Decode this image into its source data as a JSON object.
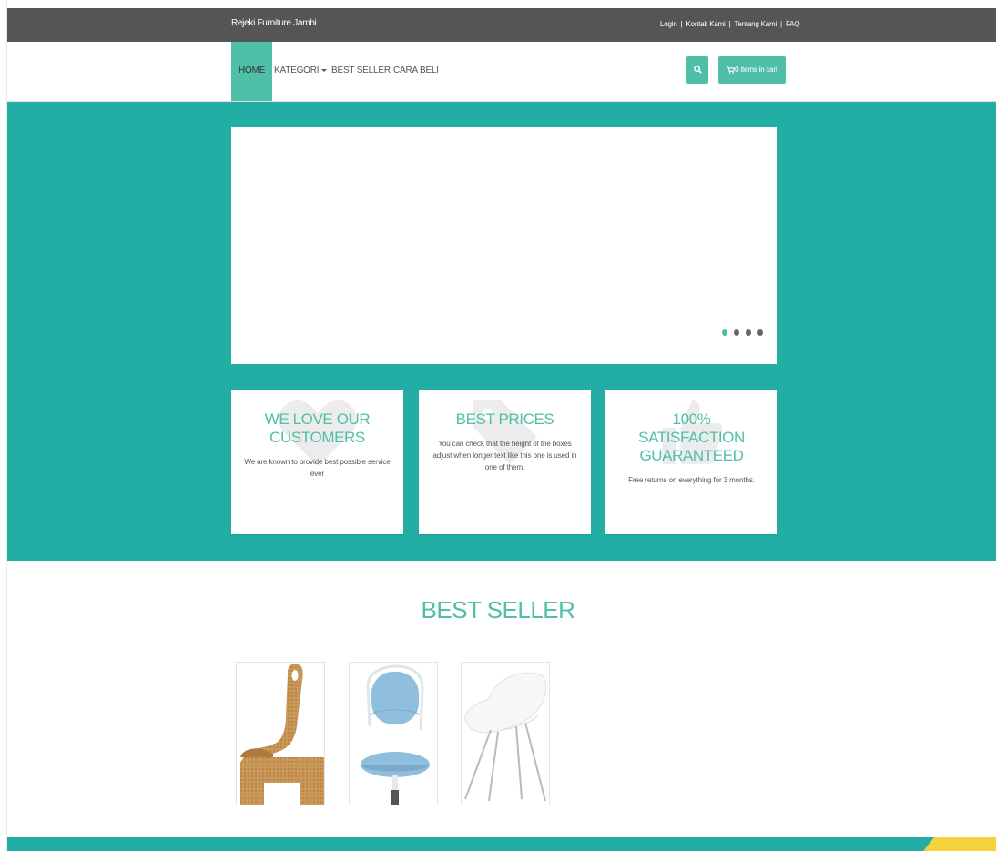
{
  "topbar": {
    "brand": "Rejeki Furniture Jambi",
    "links": [
      {
        "label": "Login"
      },
      {
        "label": "Kontak Kami"
      },
      {
        "label": "Tentang Kami"
      },
      {
        "label": "FAQ"
      }
    ],
    "separator": "|"
  },
  "nav": {
    "home": "HOME",
    "kategori": "KATEGORI",
    "best_seller": "BEST SELLER",
    "cara_beli": "CARA BELI",
    "cart_label": "0 items in cart"
  },
  "features": [
    {
      "title": "WE LOVE OUR CUSTOMERS",
      "text": "We are known to provide best possible service ever",
      "icon": "heart-icon"
    },
    {
      "title": "BEST PRICES",
      "text": "You can check that the height of the boxes adjust when longer text like this one is used in one of them.",
      "icon": "tags-icon"
    },
    {
      "title": "100% SATISFACTION GUARANTEED",
      "text": "Free returns on everything for 3 months.",
      "icon": "thumbs-up-icon"
    }
  ],
  "best_seller": {
    "title": "BEST SELLER",
    "products": [
      {
        "icon": "wooden-chair-image"
      },
      {
        "icon": "blue-office-chair-image"
      },
      {
        "icon": "white-shell-chair-image"
      }
    ]
  },
  "colors": {
    "primary": "#4fbfa8",
    "hero_bg": "#22aea5",
    "topbar_bg": "#555555",
    "accent": "#f5d13c"
  }
}
